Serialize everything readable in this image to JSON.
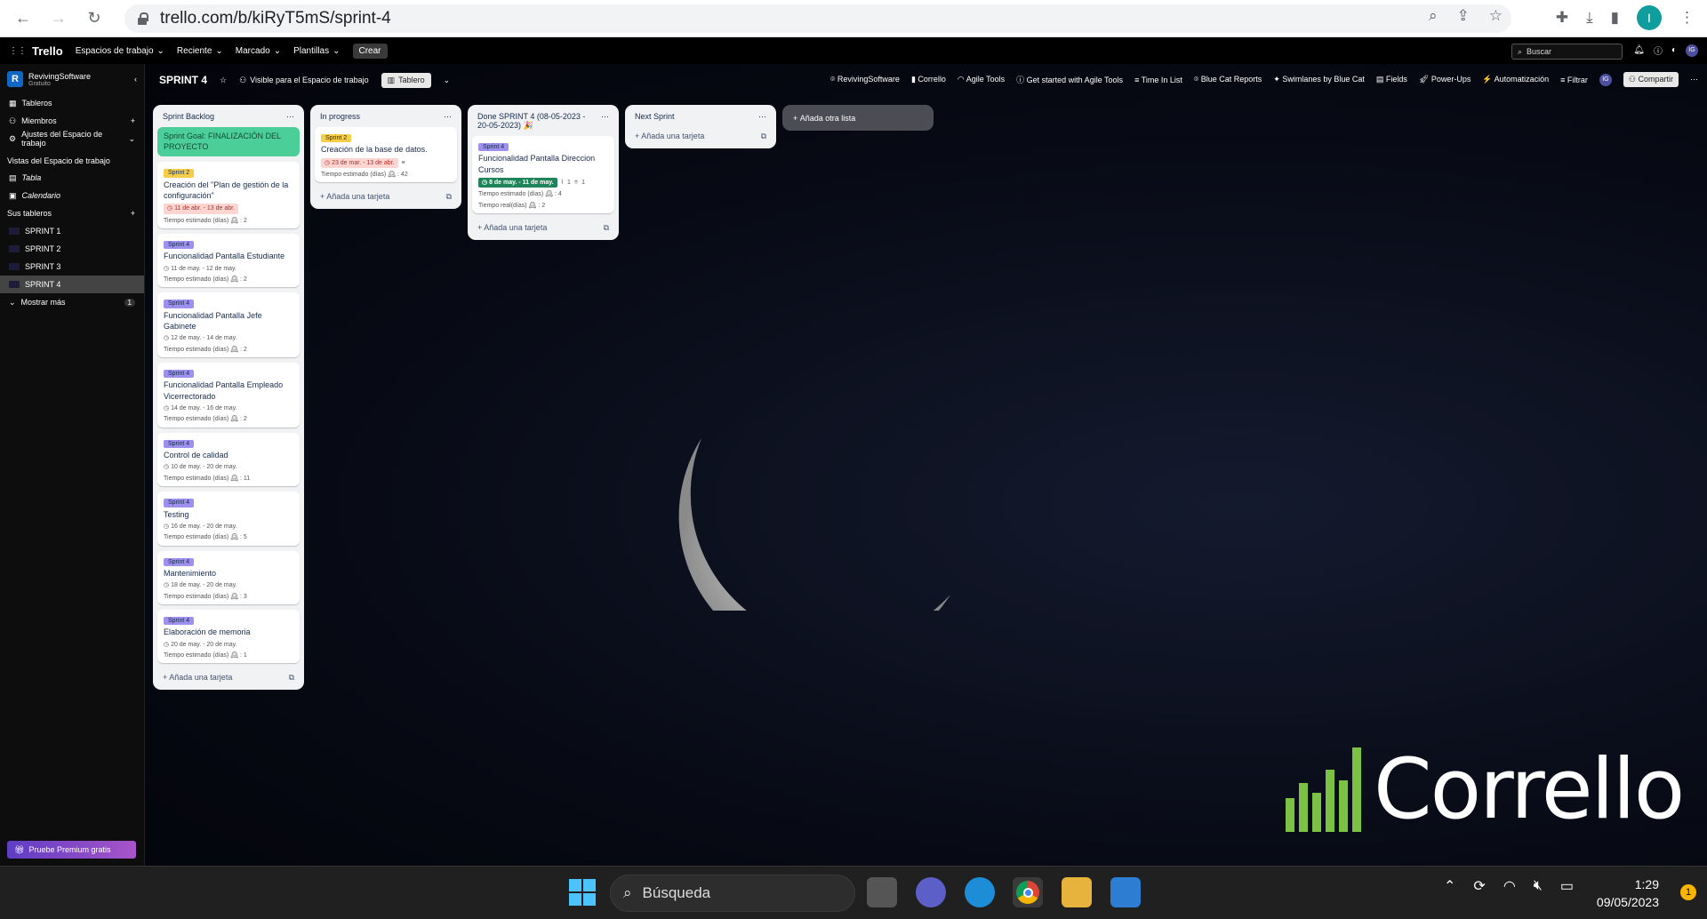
{
  "browser": {
    "url": "trello.com/b/kiRyT5mS/sprint-4",
    "profile_initial": "I"
  },
  "topnav": {
    "logo": "Trello",
    "menus": [
      "Espacios de trabajo",
      "Reciente",
      "Marcado",
      "Plantillas"
    ],
    "create": "Crear",
    "search": "Buscar",
    "avatar": "IG"
  },
  "sidebar": {
    "workspace": "RevivingSoftware",
    "plan": "Gratuito",
    "logo_letter": "R",
    "items": [
      "Tableros",
      "Miembros",
      "Ajustes del Espacio de trabajo"
    ],
    "views_heading": "Vistas del Espacio de trabajo",
    "views": [
      "Tabla",
      "Calendario"
    ],
    "boards_heading": "Sus tableros",
    "boards": [
      "SPRINT 1",
      "SPRINT 2",
      "SPRINT 3",
      "SPRINT 4"
    ],
    "more": "Mostrar más",
    "more_count": "1",
    "premium": "Pruebe Premium gratis"
  },
  "board": {
    "title": "SPRINT 4",
    "visibility": "Visible para el Espacio de trabajo",
    "view": "Tablero",
    "powerups": [
      "RevivingSoftware",
      "Corrello",
      "Agile Tools",
      "Get started with Agile Tools",
      "Time In List",
      "Blue Cat Reports",
      "Swimlanes by Blue Cat",
      "Fields",
      "Power-Ups",
      "Automatización",
      "Filtrar"
    ],
    "avatar": "IG",
    "share": "Compartir"
  },
  "lists": [
    {
      "title": "Sprint Backlog",
      "goal": "Sprint Goal: FINALIZACIÓN DEL PROYECTO",
      "cards": [
        {
          "label": "Sprint 2",
          "label_color": "#f5cd47",
          "title": "Creación del \"Plan de gestión de la configuración\"",
          "date": "11 de abr. - 13 de abr.",
          "date_style": "red",
          "est": "Tiempo estimado (días) 🕰 : 2"
        },
        {
          "label": "Sprint 4",
          "label_color": "#9f8fef",
          "title": "Funcionalidad Pantalla Estudiante",
          "date": "11 de may. - 12 de may.",
          "date_style": "plain",
          "est": "Tiempo estimado (días) 🕰 : 2"
        },
        {
          "label": "Sprint 4",
          "label_color": "#9f8fef",
          "title": "Funcionalidad Pantalla Jefe Gabinete",
          "date": "12 de may. - 14 de may.",
          "date_style": "plain",
          "est": "Tiempo estimado (días) 🕰 : 2"
        },
        {
          "label": "Sprint 4",
          "label_color": "#9f8fef",
          "title": "Funcionalidad Pantalla Empleado Vicerrectorado",
          "date": "14 de may. - 16 de may.",
          "date_style": "plain",
          "est": "Tiempo estimado (días) 🕰 : 2"
        },
        {
          "label": "Sprint 4",
          "label_color": "#9f8fef",
          "title": "Control de calidad",
          "date": "10 de may. - 20 de may.",
          "date_style": "plain",
          "est": "Tiempo estimado (días) 🕰 : 11"
        },
        {
          "label": "Sprint 4",
          "label_color": "#9f8fef",
          "title": "Testing",
          "date": "16 de may. - 20 de may.",
          "date_style": "plain",
          "est": "Tiempo estimado (días) 🕰 : 5"
        },
        {
          "label": "Sprint 4",
          "label_color": "#9f8fef",
          "title": "Mantenimiento",
          "date": "18 de may. - 20 de may.",
          "date_style": "plain",
          "est": "Tiempo estimado (días) 🕰 : 3"
        },
        {
          "label": "Sprint 4",
          "label_color": "#9f8fef",
          "title": "Elaboración de memoria",
          "date": "20 de may. - 20 de may.",
          "date_style": "plain",
          "est": "Tiempo estimado (días) 🕰 : 1"
        }
      ],
      "add": "Añada una tarjeta"
    },
    {
      "title": "In progress",
      "cards": [
        {
          "label": "Sprint 2",
          "label_color": "#f5cd47",
          "title": "Creación de la base de datos.",
          "date": "23 de mar. - 13 de abr.",
          "date_style": "red",
          "est": "Tiempo estimado (días) 🕰 : 42"
        }
      ],
      "add": "Añada una tarjeta"
    },
    {
      "title": "Done SPRINT 4 (08-05-2023 - 20-05-2023) 🎉",
      "cards": [
        {
          "label": "Sprint 4",
          "label_color": "#9f8fef",
          "title": "Funcionalidad Pantalla Direccion Cursos",
          "date": "8 de may. - 11 de may.",
          "date_style": "green",
          "attach": "1",
          "gh": "1",
          "est": "Tiempo estimado (días) 🕰 : 4",
          "real": "Tiempo real(días) 🕰 : 2"
        }
      ],
      "add": "Añada una tarjeta"
    },
    {
      "title": "Next Sprint",
      "cards": [],
      "add": "Añada una tarjeta"
    }
  ],
  "add_list": "Añada otra lista",
  "watermark": "Corrello",
  "taskbar": {
    "search": "Búsqueda",
    "time": "1:29",
    "date": "09/05/2023",
    "notif": "1"
  }
}
